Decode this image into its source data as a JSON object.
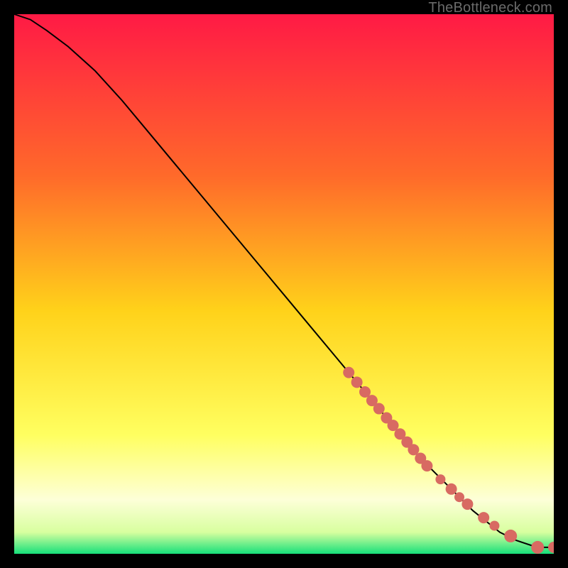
{
  "watermark": "TheBottleneck.com",
  "colors": {
    "marker_fill": "#d86a62",
    "marker_stroke": "#aa4b45",
    "curve": "#000000",
    "bg_black": "#000000",
    "grad_top": "#ff1a45",
    "grad_mid1": "#ff6a2a",
    "grad_mid2": "#ffd21a",
    "grad_mid3": "#ffff60",
    "grad_mid4": "#fdffd8",
    "grad_mid5": "#d8ff9f",
    "grad_bottom": "#16e07a"
  },
  "chart_data": {
    "type": "line",
    "title": "",
    "xlabel": "",
    "ylabel": "",
    "xlim": [
      0,
      100
    ],
    "ylim": [
      0,
      100
    ],
    "series": [
      {
        "name": "curve",
        "x": [
          0,
          3,
          6,
          10,
          15,
          20,
          25,
          30,
          35,
          40,
          45,
          50,
          55,
          60,
          65,
          70,
          75,
          80,
          85,
          90,
          93,
          96,
          98,
          100
        ],
        "y": [
          100,
          99,
          97,
          94,
          89.5,
          84,
          78,
          72,
          66,
          60,
          54,
          48,
          42,
          36,
          30,
          24,
          18,
          13,
          8,
          4,
          2.5,
          1.5,
          1.2,
          1.2
        ]
      }
    ],
    "markers": {
      "name": "dots",
      "x": [
        62,
        63.5,
        65,
        66.3,
        67.6,
        69,
        70.2,
        71.5,
        72.8,
        74,
        75.3,
        76.5,
        79,
        81,
        82.5,
        84,
        87,
        89,
        92,
        97,
        100
      ],
      "y": [
        33.6,
        31.8,
        30,
        28.4,
        26.9,
        25.2,
        23.8,
        22.2,
        20.7,
        19.3,
        17.7,
        16.3,
        13.8,
        12,
        10.5,
        9.2,
        6.7,
        5.2,
        3.3,
        1.2,
        1.2
      ],
      "r": [
        8,
        8,
        8,
        8,
        8,
        8,
        8,
        8,
        8,
        8,
        8,
        8,
        7,
        8,
        7,
        8,
        8,
        7,
        9,
        9,
        8
      ]
    }
  }
}
